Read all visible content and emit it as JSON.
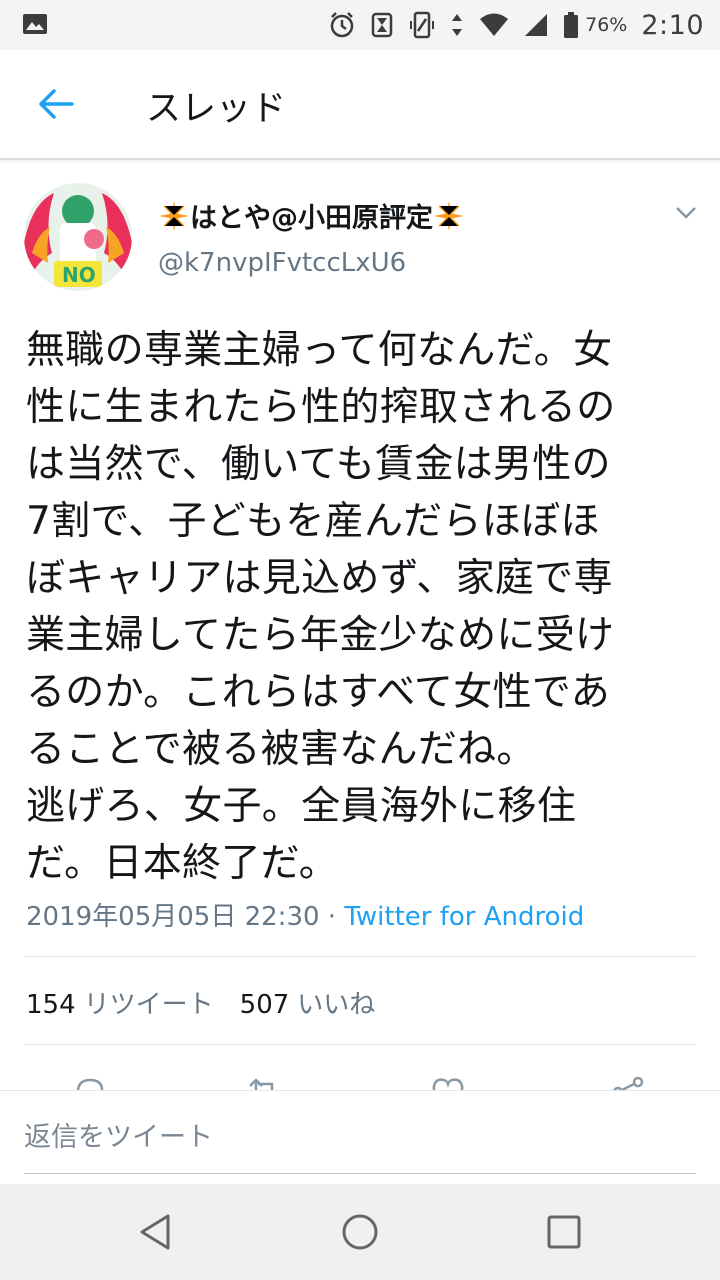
{
  "status_bar": {
    "battery_percent": "76%",
    "time": "2:10",
    "icons": [
      "gallery-icon",
      "alarm-icon",
      "hourglass-icon",
      "vibrate-icon",
      "data-arrows-icon",
      "wifi-icon",
      "signal-icon",
      "battery-icon"
    ]
  },
  "app_bar": {
    "title": "スレッド"
  },
  "tweet": {
    "display_name": "はとや@小田原評定",
    "handle": "@k7nvpIFvtccLxU6",
    "text_lines": [
      "無職の専業主婦って何なんだ。女",
      "性に生まれたら性的搾取されるの",
      "は当然で、働いても賃金は男性の",
      "7割で、子どもを産んだらほぼほ",
      "ぼキャリアは見込めず、家庭で専",
      "業主婦してたら年金少なめに受け",
      "るのか。これらはすべて女性であ",
      "ることで被る被害なんだね。",
      "逃げろ、女子。全員海外に移住",
      "だ。日本終了だ。"
    ],
    "timestamp": "2019年05月05日 22:30",
    "separator": " · ",
    "source": "Twitter for Android",
    "retweet_count": "154",
    "retweet_label": "リツイート",
    "like_count": "507",
    "like_label": "いいね"
  },
  "reply": {
    "placeholder": "返信をツイート"
  },
  "colors": {
    "accent": "#1da1f2",
    "text_primary": "#14171a",
    "text_secondary": "#657786",
    "sparkle": "#f59e1b"
  }
}
